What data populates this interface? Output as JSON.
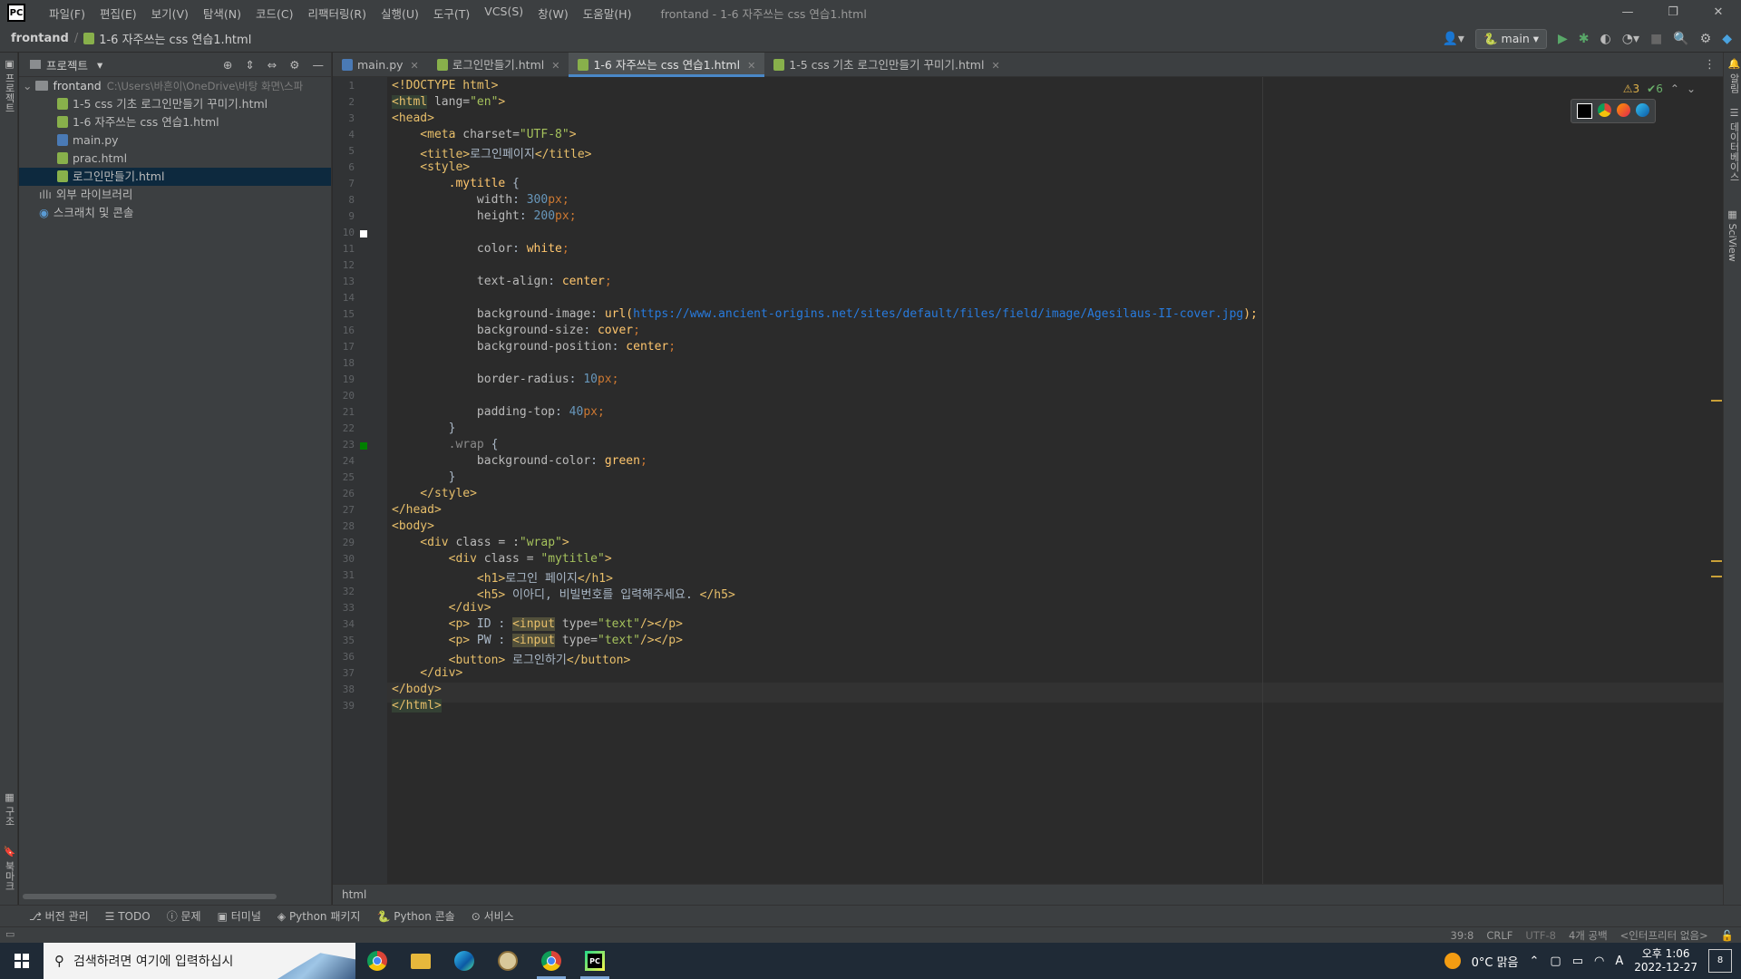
{
  "app": {
    "logo": "PC",
    "menu": [
      "파일(F)",
      "편집(E)",
      "보기(V)",
      "탐색(N)",
      "코드(C)",
      "리팩터링(R)",
      "실행(U)",
      "도구(T)",
      "VCS(S)",
      "창(W)",
      "도움말(H)"
    ],
    "window_title": "frontand - 1-6 자주쓰는 css 연습1.html",
    "window_controls": [
      "—",
      "❐",
      "✕"
    ]
  },
  "navbar": {
    "project": "frontand",
    "separator": "/",
    "file": "1-6 자주쓰는 css 연습1.html",
    "run_config": "main"
  },
  "left_strip": {
    "top_label": "프로젝트",
    "structure_label": "구조",
    "bookmarks_label": "북마크"
  },
  "right_strip": {
    "notifications_label": "알림",
    "db_label": "데이터베이스",
    "sciview_label": "SciView"
  },
  "project_panel": {
    "title": "프로젝트",
    "root": {
      "name": "frontand",
      "path": "C:\\Users\\바흔이\\OneDrive\\바탕 화면\\스파"
    },
    "files": [
      {
        "name": "1-5 css 기초 로그인만들기 꾸미기.html",
        "type": "html"
      },
      {
        "name": "1-6 자주쓰는 css 연습1.html",
        "type": "html"
      },
      {
        "name": "main.py",
        "type": "py"
      },
      {
        "name": "prac.html",
        "type": "html"
      },
      {
        "name": "로그인만들기.html",
        "type": "html",
        "selected": true
      }
    ],
    "external_libs": "외부 라이브러리",
    "scratches": "스크래치 및 콘솔"
  },
  "tabs": [
    {
      "label": "main.py",
      "type": "py",
      "active": false
    },
    {
      "label": "로그인만들기.html",
      "type": "html",
      "active": false
    },
    {
      "label": "1-6 자주쓰는 css 연습1.html",
      "type": "html",
      "active": true
    },
    {
      "label": "1-5 css 기초 로그인만들기 꾸미기.html",
      "type": "html",
      "active": false
    }
  ],
  "editor": {
    "inspection_warnings": "⚠3",
    "inspection_ok": "✔6",
    "line_numbers": [
      "1",
      "2",
      "3",
      "4",
      "5",
      "6",
      "7",
      "8",
      "9",
      "10",
      "11",
      "12",
      "13",
      "14",
      "15",
      "16",
      "17",
      "18",
      "19",
      "20",
      "21",
      "22",
      "23",
      "24",
      "25",
      "26",
      "27",
      "28",
      "29",
      "30",
      "31",
      "32",
      "33",
      "34",
      "35",
      "36",
      "37",
      "38",
      "39"
    ],
    "code": {
      "l1": "<!DOCTYPE html>",
      "l2a": "<html",
      "l2b": " lang=",
      "l2c": "\"en\"",
      "l2d": ">",
      "l3": "<head>",
      "l4a": "    <meta",
      "l4b": " charset=",
      "l4c": "\"UTF-8\"",
      "l4d": ">",
      "l5a": "    <title>",
      "l5b": "로그인페이지",
      "l5c": "</title>",
      "l6": "    <style>",
      "l7a": "        .mytitle",
      "l7b": " {",
      "l8a": "            width",
      "l8b": ": ",
      "l8c": "300",
      "l8d": "px",
      "l8e": ";",
      "l9a": "            height",
      "l9b": ": ",
      "l9c": "200",
      "l9d": "px",
      "l9e": ";",
      "l11a": "            color",
      "l11b": ": ",
      "l11c": "white",
      "l11d": ";",
      "l13a": "            text-align",
      "l13b": ": ",
      "l13c": "center",
      "l13d": ";",
      "l15a": "            background-image",
      "l15b": ": ",
      "l15c": "url(",
      "l15d": "https://www.ancient-origins.net/sites/default/files/field/image/Agesilaus-II-cover.jpg",
      "l15e": ");",
      "l16a": "            background-size",
      "l16b": ": ",
      "l16c": "cover",
      "l16d": ";",
      "l17a": "            background-position",
      "l17b": ": ",
      "l17c": "center",
      "l17d": ";",
      "l19a": "            border-radius",
      "l19b": ": ",
      "l19c": "10",
      "l19d": "px",
      "l19e": ";",
      "l21a": "            padding-top",
      "l21b": ": ",
      "l21c": "40",
      "l21d": "px",
      "l21e": ";",
      "l22": "        }",
      "l23a": "        .wrap",
      "l23b": " {",
      "l24a": "            background-color",
      "l24b": ": ",
      "l24c": "green",
      "l24d": ";",
      "l25": "        }",
      "l26": "    </style>",
      "l27": "</head>",
      "l28": "<body>",
      "l29a": "    <div",
      "l29b": " class = :",
      "l29c": "\"wrap\"",
      "l29d": ">",
      "l30a": "        <div",
      "l30b": " class = ",
      "l30c": "\"mytitle\"",
      "l30d": ">",
      "l31a": "            <h1>",
      "l31b": "로그인 페이지",
      "l31c": "</h1>",
      "l32a": "            <h5>",
      "l32b": " 이아디, 비빌번호를 입력해주세요. ",
      "l32c": "</h5>",
      "l33": "        </div>",
      "l34a": "        <p>",
      "l34b": " ID : ",
      "l34c": "<input",
      "l34d": " type=",
      "l34e": "\"text\"",
      "l34f": "/></p>",
      "l35a": "        <p>",
      "l35b": " PW : ",
      "l35c": "<input",
      "l35d": " type=",
      "l35e": "\"text\"",
      "l35f": "/></p>",
      "l36a": "        <button>",
      "l36b": " 로그인하기",
      "l36c": "</button>",
      "l37": "    </div>",
      "l38": "</body>",
      "l39": "</html>"
    },
    "breadcrumb": "html"
  },
  "bottom_tools": [
    "버전 관리",
    "TODO",
    "문제",
    "터미널",
    "Python 패키지",
    "Python 콘솔",
    "서비스"
  ],
  "status": {
    "position": "39:8",
    "line_sep": "CRLF",
    "encoding": "UTF-8",
    "indent": "4개 공백",
    "interpreter": "<인터프리터 없음>"
  },
  "taskbar": {
    "search_placeholder": "검색하려면 여기에 입력하십시",
    "weather": "0°C  맑음",
    "time": "오후 1:06",
    "date": "2022-12-27",
    "notifications": "8"
  },
  "colors": {
    "editor_bg": "#2b2b2b",
    "panel_bg": "#3c3f41",
    "tag": "#e8bf6a",
    "string": "#a5c25c",
    "number": "#6897bb",
    "url": "#287bde"
  }
}
